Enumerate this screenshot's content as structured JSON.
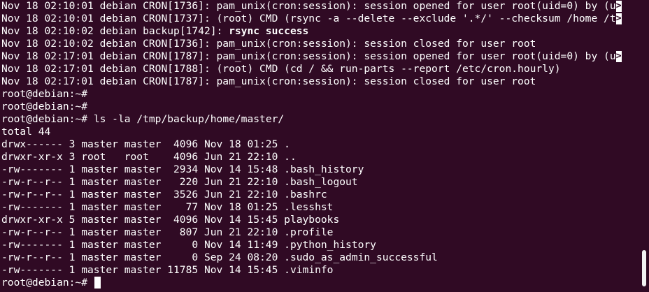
{
  "terminal": {
    "log": [
      {
        "text": "Nov 18 02:10:01 debian CRON[1736]: pam_unix(cron:session): session opened for user root(uid=0) by (u",
        "wrap": ">"
      },
      {
        "text": "Nov 18 02:10:01 debian CRON[1737]: (root) CMD (rsync -a --delete --exclude '.*/' --checksum /home /t",
        "wrap": ">"
      },
      {
        "text": "Nov 18 02:10:02 debian backup[1742]: ",
        "bold": "rsync success"
      },
      {
        "text": "Nov 18 02:10:02 debian CRON[1736]: pam_unix(cron:session): session closed for user root"
      },
      {
        "text": "Nov 18 02:17:01 debian CRON[1787]: pam_unix(cron:session): session opened for user root(uid=0) by (u",
        "wrap": ">"
      },
      {
        "text": "Nov 18 02:17:01 debian CRON[1788]: (root) CMD (cd / && run-parts --report /etc/cron.hourly)"
      },
      {
        "text": "Nov 18 02:17:01 debian CRON[1787]: pam_unix(cron:session): session closed for user root"
      }
    ],
    "prompt": "root@debian:~#",
    "empty_prompts": 2,
    "command": "ls -la /tmp/backup/home/master/",
    "total": "total 44",
    "listing": [
      "drwx------ 3 master master  4096 Nov 18 01:25 .",
      "drwxr-xr-x 3 root   root    4096 Jun 21 22:10 ..",
      "-rw------- 1 master master  2934 Nov 14 15:48 .bash_history",
      "-rw-r--r-- 1 master master   220 Jun 21 22:10 .bash_logout",
      "-rw-r--r-- 1 master master  3526 Jun 21 22:10 .bashrc",
      "-rw------- 1 master master    77 Nov 18 01:25 .lesshst",
      "drwxr-xr-x 5 master master  4096 Nov 14 15:45 playbooks",
      "-rw-r--r-- 1 master master   807 Jun 21 22:10 .profile",
      "-rw------- 1 master master     0 Nov 14 11:49 .python_history",
      "-rw-r--r-- 1 master master     0 Sep 24 08:20 .sudo_as_admin_successful",
      "-rw------- 1 master master 11785 Nov 14 15:45 .viminfo"
    ]
  },
  "colors": {
    "background": "#300a24",
    "foreground": "#ffffff",
    "scrollbar_thumb": "#f2f2f2"
  }
}
